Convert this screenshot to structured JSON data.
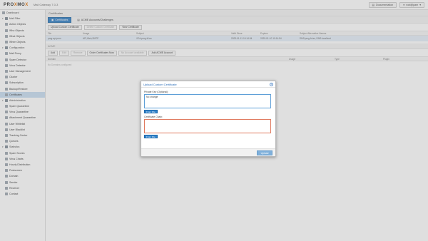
{
  "topbar": {
    "logo_prefix": "PRO",
    "logo_x": "X",
    "logo_suffix": "MO",
    "logo_x2": "X",
    "product": "Mail Gateway 7.0-3",
    "documentation": "Documentation",
    "user": "root@pam"
  },
  "sidebar": {
    "items": [
      {
        "label": "Dashboard",
        "icon": "dashboard-icon",
        "level": 0
      },
      {
        "label": "Mail Filter",
        "icon": "filter-icon",
        "level": 0,
        "group": true
      },
      {
        "label": "Action Objects",
        "icon": "action-icon",
        "level": 1
      },
      {
        "label": "Who Objects",
        "icon": "user-icon",
        "level": 1
      },
      {
        "label": "What Objects",
        "icon": "file-icon",
        "level": 1
      },
      {
        "label": "When Objects",
        "icon": "clock-icon",
        "level": 1
      },
      {
        "label": "Configuration",
        "icon": "gear-icon",
        "level": 0,
        "group": true
      },
      {
        "label": "Mail Proxy",
        "icon": "envelope-icon",
        "level": 1
      },
      {
        "label": "Spam Detector",
        "icon": "bullhorn-icon",
        "level": 1
      },
      {
        "label": "Virus Detector",
        "icon": "bug-icon",
        "level": 1
      },
      {
        "label": "User Management",
        "icon": "users-icon",
        "level": 1
      },
      {
        "label": "Cluster",
        "icon": "server-icon",
        "level": 1
      },
      {
        "label": "Subscription",
        "icon": "support-icon",
        "level": 1
      },
      {
        "label": "Backup/Restore",
        "icon": "floppy-icon",
        "level": 1
      },
      {
        "label": "Certificates",
        "icon": "certificate-icon",
        "level": 1,
        "active": true
      },
      {
        "label": "Administration",
        "icon": "wrench-icon",
        "level": 0,
        "group": true
      },
      {
        "label": "Spam Quarantine",
        "icon": "bullhorn-icon",
        "level": 1
      },
      {
        "label": "Virus Quarantine",
        "icon": "bug-icon",
        "level": 1
      },
      {
        "label": "Attachment Quarantine",
        "icon": "paperclip-icon",
        "level": 1
      },
      {
        "label": "User Whitelist",
        "icon": "list-icon",
        "level": 1
      },
      {
        "label": "User Blacklist",
        "icon": "list-icon",
        "level": 1
      },
      {
        "label": "Tracking Center",
        "icon": "search-icon",
        "level": 1
      },
      {
        "label": "Queues",
        "icon": "bars-icon",
        "level": 1
      },
      {
        "label": "Statistics",
        "icon": "chart-icon",
        "level": 0,
        "group": true
      },
      {
        "label": "Spam Scores",
        "icon": "bullhorn-icon",
        "level": 1
      },
      {
        "label": "Virus Charts",
        "icon": "bug-icon",
        "level": 1
      },
      {
        "label": "Hourly Distribution",
        "icon": "clock-icon",
        "level": 1
      },
      {
        "label": "Postscreen",
        "icon": "shield-icon",
        "level": 1
      },
      {
        "label": "Domain",
        "icon": "globe-icon",
        "level": 1
      },
      {
        "label": "Sender",
        "icon": "user-icon",
        "level": 1
      },
      {
        "label": "Receiver",
        "icon": "user-icon",
        "level": 1
      },
      {
        "label": "Contact",
        "icon": "users-icon",
        "level": 1
      }
    ]
  },
  "main": {
    "title": "Certificates",
    "tabs": [
      {
        "label": "Certificates",
        "active": true,
        "icon": "certificate-icon"
      },
      {
        "label": "ACME Accounts/Challenges",
        "active": false,
        "icon": "file-icon"
      }
    ],
    "toolbar": {
      "upload": "Upload Custom Certificate",
      "delete": "Delete Custom Certificate",
      "view": "View Certificate"
    },
    "grid": {
      "columns": [
        "File",
        "Usage",
        "Subject",
        "Valid Since",
        "Expires",
        "Subject Alternative Names"
      ],
      "rows": [
        [
          "pmg-api.pem",
          "API,Web,SMTP",
          "/CN=pmg-fr.lan",
          "2023-01-11 10:14:54",
          "2025-01-10 10:14:54",
          "DNS:pmg-fr.lan, DNS:localhost"
        ]
      ]
    },
    "acme": {
      "title": "ACME",
      "toolbar": [
        "Add",
        "Edit",
        "Remove",
        "Order Certificates Now"
      ],
      "account_label": "No Account available.",
      "add_account": "Add ACME Account",
      "columns": [
        "Domain",
        "Usage",
        "Type",
        "Plugin"
      ],
      "empty": "No Domains configured"
    }
  },
  "dialog": {
    "title": "Upload Custom Certificate",
    "private_key_label": "Private Key (Optional):",
    "private_key_value": "No change",
    "certificate_label": "Certificate Chain:",
    "certificate_value": "",
    "from_file": "From File",
    "upload": "Upload"
  }
}
